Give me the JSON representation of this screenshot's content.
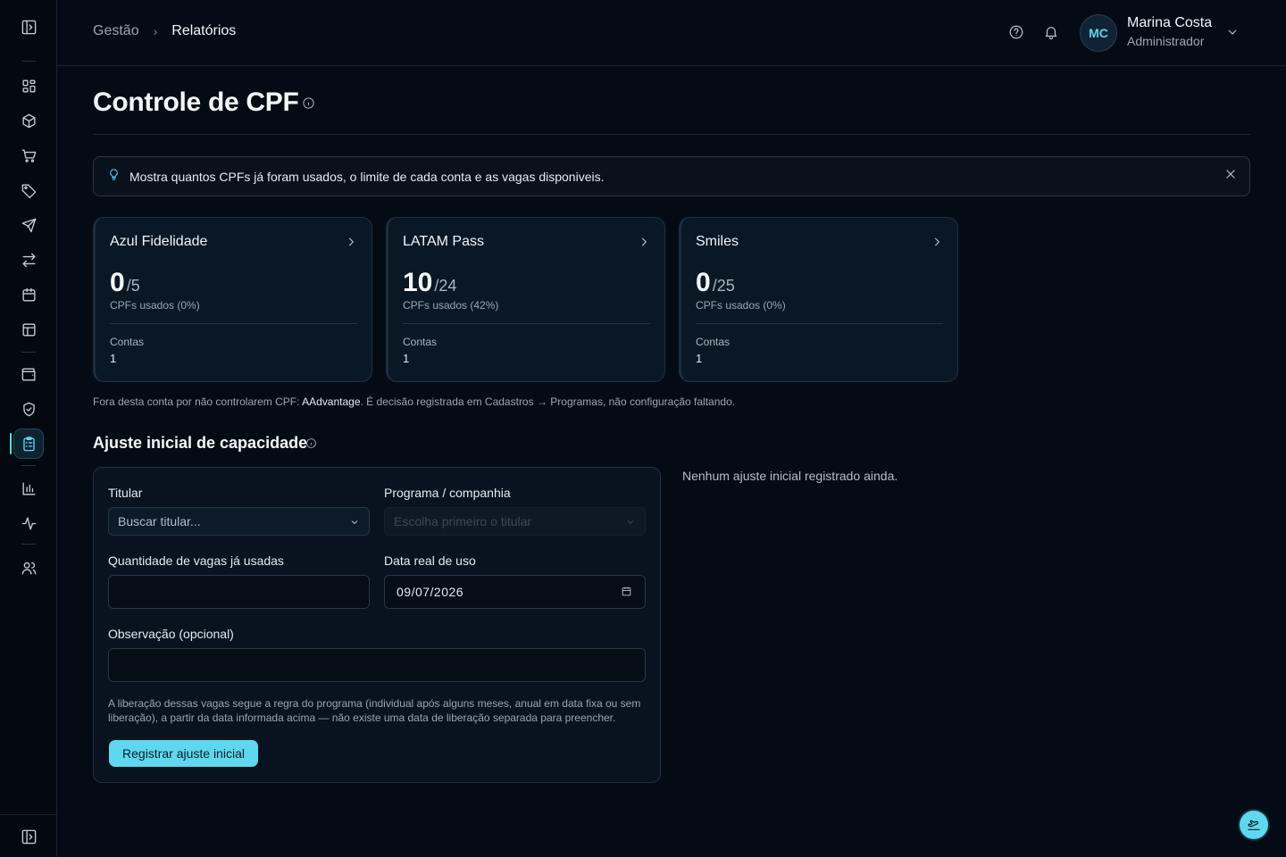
{
  "breadcrumb": {
    "parent": "Gestão",
    "current": "Relatórios"
  },
  "user": {
    "initials": "MC",
    "name": "Marina Costa",
    "role": "Administrador"
  },
  "page": {
    "title": "Controle de CPF"
  },
  "alert": {
    "text": "Mostra quantos CPFs já foram usados, o limite de cada conta e as vagas disponiveis."
  },
  "cards": [
    {
      "name": "Azul Fidelidade",
      "used": "0",
      "total": "/5",
      "subtitle": "CPFs usados (0%)",
      "accounts_label": "Contas",
      "accounts": "1"
    },
    {
      "name": "LATAM Pass",
      "used": "10",
      "total": "/24",
      "subtitle": "CPFs usados (42%)",
      "accounts_label": "Contas",
      "accounts": "1"
    },
    {
      "name": "Smiles",
      "used": "0",
      "total": "/25",
      "subtitle": "CPFs usados (0%)",
      "accounts_label": "Contas",
      "accounts": "1"
    }
  ],
  "footnote": {
    "prefix": "Fora desta conta por não controlarem CPF: ",
    "program": "AAdvantage",
    "suffix": ". É decisão registrada em Cadastros → Programas, não configuração faltando."
  },
  "adjust": {
    "title": "Ajuste inicial de capacidade",
    "holder_label": "Titular",
    "holder_placeholder": "Buscar titular...",
    "program_label": "Programa / companhia",
    "program_placeholder": "Escolha primeiro o titular",
    "quantity_label": "Quantidade de vagas já usadas",
    "quantity_value": "",
    "date_label": "Data real de uso",
    "date_value": "09/07/2026",
    "note_label": "Observação (opcional)",
    "note_value": "",
    "help": "A liberação dessas vagas segue a regra do programa (individual após alguns meses, anual em data fixa ou sem liberação), a partir da data informada acima — não existe uma data de liberação separada para preencher.",
    "submit_label": "Registrar ajuste inicial",
    "empty_message": "Nenhum ajuste inicial registrado ainda."
  },
  "colors": {
    "accent": "#5fd7ee",
    "background": "#050b14",
    "card": "#0a1826"
  },
  "sidebar_icons": [
    "sidebar-toggle-icon",
    "dashboard-grid-icon",
    "package-box-icon",
    "shopping-cart-icon",
    "tag-icon",
    "airplane-icon",
    "transfer-arrows-icon",
    "calendar-icon",
    "layout-panel-icon",
    "wallet-icon",
    "shield-check-icon",
    "clipboard-list-icon",
    "bar-chart-icon",
    "activity-pulse-icon",
    "users-icon"
  ]
}
